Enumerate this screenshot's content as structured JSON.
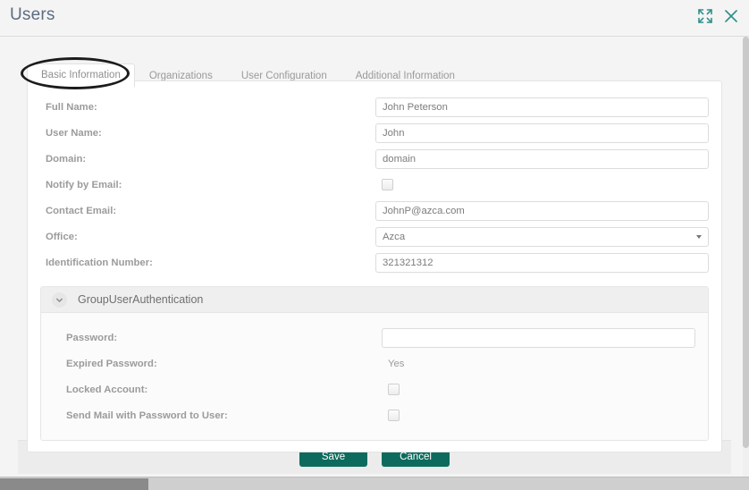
{
  "header": {
    "title": "Users",
    "expand_icon": "expand-icon",
    "close_icon": "close-icon"
  },
  "tabs": [
    {
      "label": "Basic Information",
      "active": true
    },
    {
      "label": "Organizations",
      "active": false
    },
    {
      "label": "User Configuration",
      "active": false
    },
    {
      "label": "Additional Information",
      "active": false
    }
  ],
  "form": {
    "fields": [
      {
        "label": "Full Name:",
        "type": "text",
        "value": "John Peterson"
      },
      {
        "label": "User Name:",
        "type": "text",
        "value": "John"
      },
      {
        "label": "Domain:",
        "type": "text",
        "value": "domain"
      },
      {
        "label": "Notify by Email:",
        "type": "checkbox",
        "checked": false
      },
      {
        "label": "Contact Email:",
        "type": "text",
        "value": "JohnP@azca.com"
      },
      {
        "label": "Office:",
        "type": "select",
        "value": "Azca"
      },
      {
        "label": "Identification Number:",
        "type": "text",
        "value": "321321312"
      }
    ]
  },
  "group": {
    "title": "GroupUserAuthentication",
    "collapse_icon": "chevron-down-icon",
    "fields": [
      {
        "label": "Password:",
        "type": "password",
        "value": ""
      },
      {
        "label": "Expired Password:",
        "type": "static",
        "value": "Yes"
      },
      {
        "label": "Locked Account:",
        "type": "checkbox",
        "checked": false
      },
      {
        "label": "Send Mail with Password to User:",
        "type": "checkbox",
        "checked": false
      }
    ]
  },
  "footer": {
    "save_label": "Save",
    "cancel_label": "Cancel"
  },
  "colors": {
    "accent": "#0d6b5e",
    "title": "#5d6c82",
    "label": "#9b9b9b",
    "page_bg": "#f4f4f4"
  }
}
